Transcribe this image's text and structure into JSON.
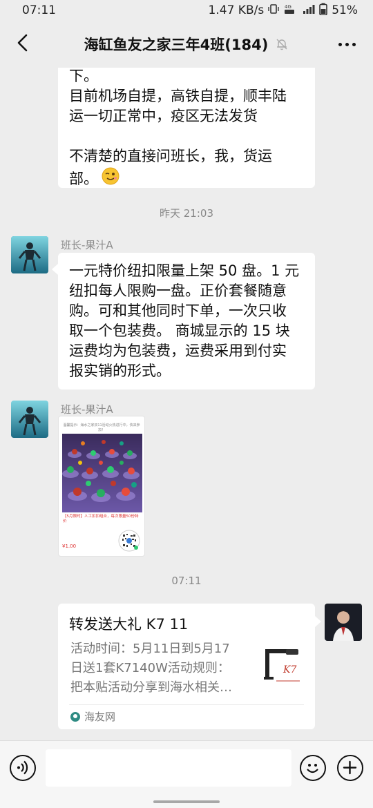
{
  "status_bar": {
    "time": "07:11",
    "net_speed": "1.47 KB/s",
    "network": "4G",
    "battery": "51%"
  },
  "header": {
    "title": "海缸鱼友之家三年4班(184)",
    "back_icon": "chevron-left-icon",
    "mute_icon": "bell-muted-icon",
    "more_icon": "ellipsis-icon"
  },
  "messages": {
    "msg1": {
      "lines": [
        "下。",
        "目前机场自提，高铁自提，顺丰陆",
        "运一切正常中，疫区无法发货",
        "",
        "不清楚的直接问班长，我，货运",
        "部。"
      ],
      "emoji": "wink-emoji"
    },
    "time1": "昨天 21:03",
    "msg2": {
      "sender": "班长-果汁A",
      "lines": [
        "一元特价纽扣限量上架 50 盘。1 元",
        "纽扣每人限购一盘。正价套餐随意",
        "购。可和其他同时下单，一次只收",
        "取一个包装费。 商城显示的 15 块",
        "运费均为包装费，运费采用到付实",
        "报实销的形式。"
      ]
    },
    "msg3": {
      "sender": "班长-果汁A",
      "image_header": "温馨提示：海水之家双11活动火热进行中，快来参加！",
      "image_caption": "【5月限时】人工扣扣组合，每次限量50份特价",
      "image_price": "¥1.00"
    },
    "time2": "07:11",
    "card": {
      "title": "转发送大礼 K7 11",
      "desc": [
        "活动时间：5月11日到5月17",
        "日送1套K7140W活动规则：",
        "把本贴活动分享到海水相关…"
      ],
      "source": "海友网"
    }
  },
  "input_bar": {
    "voice_icon": "voice-icon",
    "emoji_icon": "emoji-icon",
    "plus_icon": "plus-icon"
  }
}
